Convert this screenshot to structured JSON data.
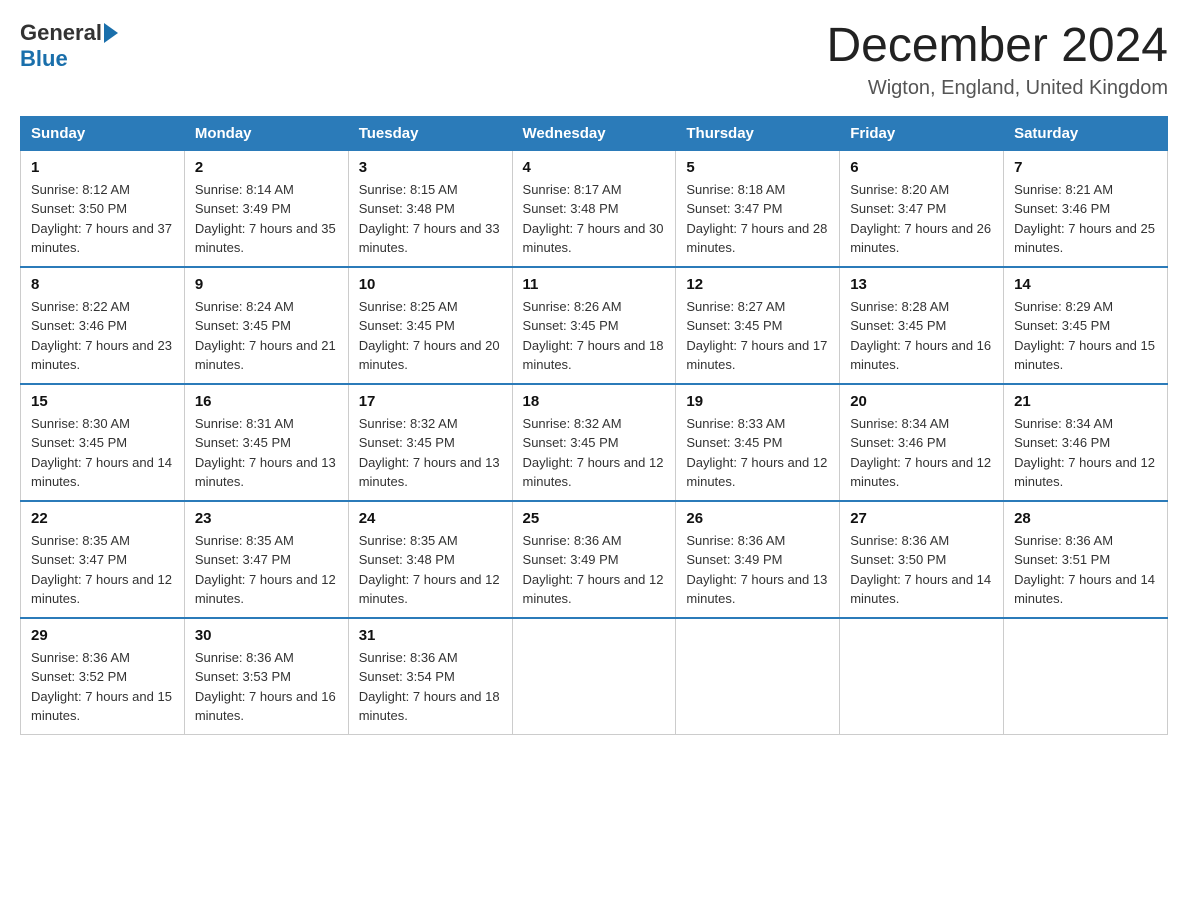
{
  "header": {
    "logo_general": "General",
    "logo_blue": "Blue",
    "month_title": "December 2024",
    "location": "Wigton, England, United Kingdom"
  },
  "weekdays": [
    "Sunday",
    "Monday",
    "Tuesday",
    "Wednesday",
    "Thursday",
    "Friday",
    "Saturday"
  ],
  "weeks": [
    [
      {
        "day": "1",
        "sunrise": "8:12 AM",
        "sunset": "3:50 PM",
        "daylight": "7 hours and 37 minutes."
      },
      {
        "day": "2",
        "sunrise": "8:14 AM",
        "sunset": "3:49 PM",
        "daylight": "7 hours and 35 minutes."
      },
      {
        "day": "3",
        "sunrise": "8:15 AM",
        "sunset": "3:48 PM",
        "daylight": "7 hours and 33 minutes."
      },
      {
        "day": "4",
        "sunrise": "8:17 AM",
        "sunset": "3:48 PM",
        "daylight": "7 hours and 30 minutes."
      },
      {
        "day": "5",
        "sunrise": "8:18 AM",
        "sunset": "3:47 PM",
        "daylight": "7 hours and 28 minutes."
      },
      {
        "day": "6",
        "sunrise": "8:20 AM",
        "sunset": "3:47 PM",
        "daylight": "7 hours and 26 minutes."
      },
      {
        "day": "7",
        "sunrise": "8:21 AM",
        "sunset": "3:46 PM",
        "daylight": "7 hours and 25 minutes."
      }
    ],
    [
      {
        "day": "8",
        "sunrise": "8:22 AM",
        "sunset": "3:46 PM",
        "daylight": "7 hours and 23 minutes."
      },
      {
        "day": "9",
        "sunrise": "8:24 AM",
        "sunset": "3:45 PM",
        "daylight": "7 hours and 21 minutes."
      },
      {
        "day": "10",
        "sunrise": "8:25 AM",
        "sunset": "3:45 PM",
        "daylight": "7 hours and 20 minutes."
      },
      {
        "day": "11",
        "sunrise": "8:26 AM",
        "sunset": "3:45 PM",
        "daylight": "7 hours and 18 minutes."
      },
      {
        "day": "12",
        "sunrise": "8:27 AM",
        "sunset": "3:45 PM",
        "daylight": "7 hours and 17 minutes."
      },
      {
        "day": "13",
        "sunrise": "8:28 AM",
        "sunset": "3:45 PM",
        "daylight": "7 hours and 16 minutes."
      },
      {
        "day": "14",
        "sunrise": "8:29 AM",
        "sunset": "3:45 PM",
        "daylight": "7 hours and 15 minutes."
      }
    ],
    [
      {
        "day": "15",
        "sunrise": "8:30 AM",
        "sunset": "3:45 PM",
        "daylight": "7 hours and 14 minutes."
      },
      {
        "day": "16",
        "sunrise": "8:31 AM",
        "sunset": "3:45 PM",
        "daylight": "7 hours and 13 minutes."
      },
      {
        "day": "17",
        "sunrise": "8:32 AM",
        "sunset": "3:45 PM",
        "daylight": "7 hours and 13 minutes."
      },
      {
        "day": "18",
        "sunrise": "8:32 AM",
        "sunset": "3:45 PM",
        "daylight": "7 hours and 12 minutes."
      },
      {
        "day": "19",
        "sunrise": "8:33 AM",
        "sunset": "3:45 PM",
        "daylight": "7 hours and 12 minutes."
      },
      {
        "day": "20",
        "sunrise": "8:34 AM",
        "sunset": "3:46 PM",
        "daylight": "7 hours and 12 minutes."
      },
      {
        "day": "21",
        "sunrise": "8:34 AM",
        "sunset": "3:46 PM",
        "daylight": "7 hours and 12 minutes."
      }
    ],
    [
      {
        "day": "22",
        "sunrise": "8:35 AM",
        "sunset": "3:47 PM",
        "daylight": "7 hours and 12 minutes."
      },
      {
        "day": "23",
        "sunrise": "8:35 AM",
        "sunset": "3:47 PM",
        "daylight": "7 hours and 12 minutes."
      },
      {
        "day": "24",
        "sunrise": "8:35 AM",
        "sunset": "3:48 PM",
        "daylight": "7 hours and 12 minutes."
      },
      {
        "day": "25",
        "sunrise": "8:36 AM",
        "sunset": "3:49 PM",
        "daylight": "7 hours and 12 minutes."
      },
      {
        "day": "26",
        "sunrise": "8:36 AM",
        "sunset": "3:49 PM",
        "daylight": "7 hours and 13 minutes."
      },
      {
        "day": "27",
        "sunrise": "8:36 AM",
        "sunset": "3:50 PM",
        "daylight": "7 hours and 14 minutes."
      },
      {
        "day": "28",
        "sunrise": "8:36 AM",
        "sunset": "3:51 PM",
        "daylight": "7 hours and 14 minutes."
      }
    ],
    [
      {
        "day": "29",
        "sunrise": "8:36 AM",
        "sunset": "3:52 PM",
        "daylight": "7 hours and 15 minutes."
      },
      {
        "day": "30",
        "sunrise": "8:36 AM",
        "sunset": "3:53 PM",
        "daylight": "7 hours and 16 minutes."
      },
      {
        "day": "31",
        "sunrise": "8:36 AM",
        "sunset": "3:54 PM",
        "daylight": "7 hours and 18 minutes."
      },
      null,
      null,
      null,
      null
    ]
  ]
}
